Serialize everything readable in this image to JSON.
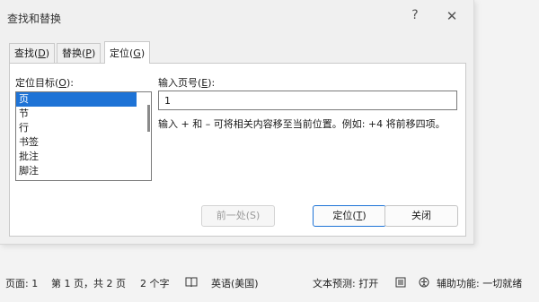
{
  "dialog": {
    "title": "查找和替换",
    "help_glyph": "?",
    "close_glyph": "✕"
  },
  "tabs": [
    {
      "label": "查找",
      "hotkey": "D"
    },
    {
      "label": "替换",
      "hotkey": "P"
    },
    {
      "label": "定位",
      "hotkey": "G",
      "active": true
    }
  ],
  "target": {
    "label": "定位目标",
    "hotkey": "O",
    "items": [
      "页",
      "节",
      "行",
      "书签",
      "批注",
      "脚注"
    ],
    "selected": "页"
  },
  "page_input": {
    "label": "输入页号",
    "hotkey": "E",
    "value": "1",
    "hint": "输入 + 和 – 可将相关内容移至当前位置。例如: +4 将前移四项。"
  },
  "buttons": {
    "previous": {
      "label": "前一处",
      "hotkey": "S",
      "enabled": false
    },
    "goto": {
      "label": "定位",
      "hotkey": "T",
      "enabled": true
    },
    "close": {
      "label": "关闭"
    }
  },
  "statusbar": {
    "page": "页面: 1",
    "page_of": "第 1 页，共 2 页",
    "words": "2 个字",
    "language": "英语(美国)",
    "text_prediction": "文本预测: 打开",
    "accessibility": "辅助功能: 一切就绪"
  },
  "colors": {
    "accent": "#1e73d6",
    "dialog_bg": "#f0f0f0"
  }
}
